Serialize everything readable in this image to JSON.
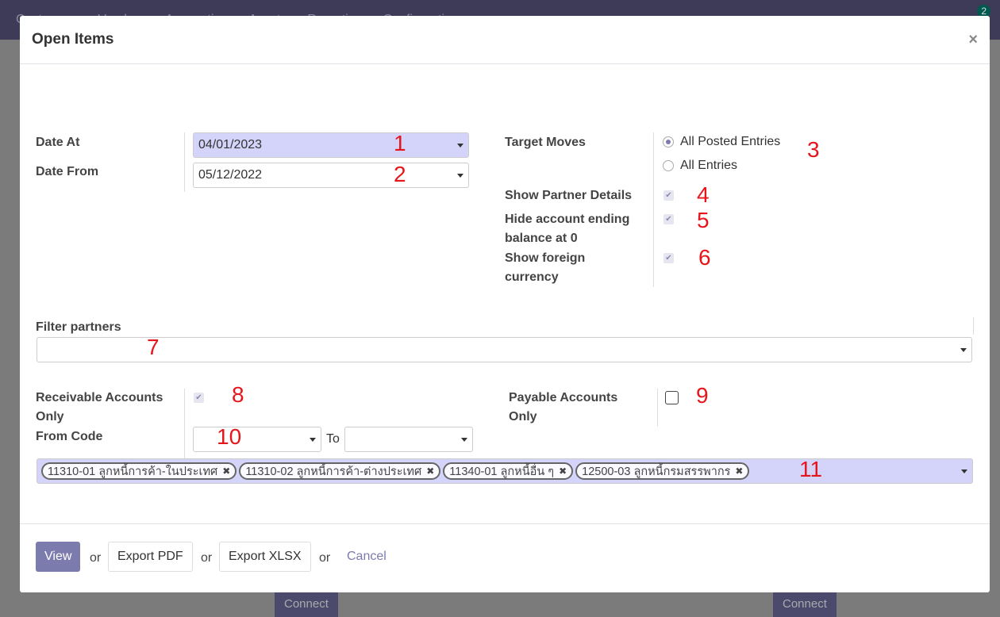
{
  "background": {
    "nav": [
      "Customers",
      "Vendors",
      "Accounting",
      "Assets",
      "Reporting",
      "Configuration"
    ],
    "badge": "2",
    "connect": "Connect"
  },
  "dialog": {
    "title": "Open Items",
    "close": "×",
    "date_at": {
      "label": "Date At",
      "value": "04/01/2023"
    },
    "date_from": {
      "label": "Date From",
      "value": "05/12/2022"
    },
    "target_moves": {
      "label": "Target Moves",
      "options": [
        "All Posted Entries",
        "All Entries"
      ],
      "selected": "All Posted Entries"
    },
    "show_partner_details": {
      "label": "Show Partner Details",
      "checked": true
    },
    "hide_zero": {
      "label": "Hide account ending balance at 0",
      "checked": true
    },
    "show_foreign": {
      "label": "Show foreign currency",
      "checked": true
    },
    "filter_partners": {
      "label": "Filter partners",
      "value": ""
    },
    "receivable_only": {
      "label": "Receivable Accounts Only",
      "checked": true
    },
    "payable_only": {
      "label": "Payable Accounts Only",
      "checked": false
    },
    "from_code": {
      "label": "From Code",
      "value": "",
      "to_label": "To",
      "to_value": ""
    },
    "accounts": [
      "11310-01 ลูกหนี้การค้า-ในประเทศ",
      "11310-02 ลูกหนี้การค้า-ต่างประเทศ",
      "11340-01 ลูกหนี้อื่น ๆ",
      "12500-03 ลูกหนี้กรมสรรพากร"
    ],
    "footer": {
      "view": "View",
      "or": "or",
      "export_pdf": "Export PDF",
      "export_xlsx": "Export XLSX",
      "cancel": "Cancel"
    }
  },
  "annotations": [
    "1",
    "2",
    "3",
    "4",
    "5",
    "6",
    "7",
    "8",
    "9",
    "10",
    "11"
  ],
  "colors": {
    "primary": "#7c7bad",
    "highlight": "#d4d4fb",
    "annotation": "#e5161b"
  }
}
